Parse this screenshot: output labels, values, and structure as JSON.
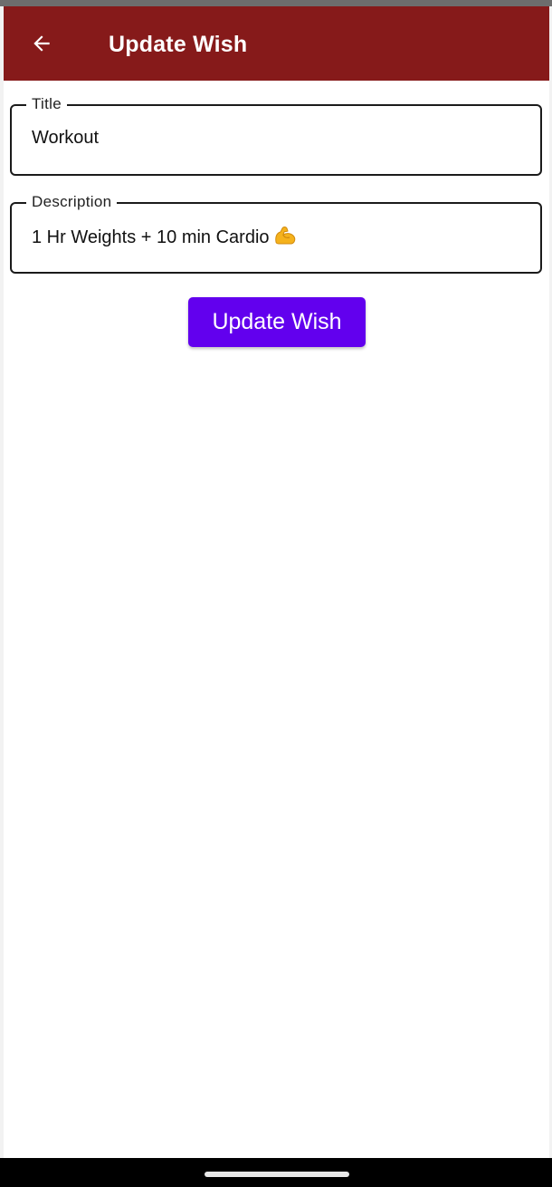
{
  "top_bar": {
    "title": "Update Wish",
    "back_icon": "arrow-back-icon",
    "background_color": "#861a1a"
  },
  "form": {
    "title_field": {
      "label": "Title",
      "value": "Workout"
    },
    "description_field": {
      "label": "Description",
      "value": "1 Hr Weights + 10 min Cardio",
      "trailing_emoji_icon": "flexed-biceps-icon"
    },
    "submit_button": {
      "label": "Update Wish",
      "color": "#6200ee"
    }
  },
  "system_nav": {
    "home_indicator_icon": "home-handle-icon"
  }
}
